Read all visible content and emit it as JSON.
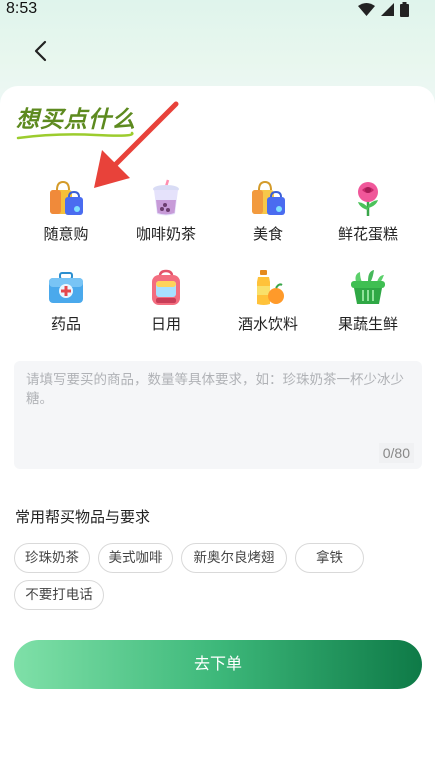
{
  "status_bar": {
    "time": "8:53"
  },
  "slogan": "想买点什么",
  "categories": [
    {
      "label": "随意购",
      "icon": "shopping-bag-icon"
    },
    {
      "label": "咖啡奶茶",
      "icon": "bubble-tea-icon"
    },
    {
      "label": "美食",
      "icon": "food-bag-icon"
    },
    {
      "label": "鲜花蛋糕",
      "icon": "rose-icon"
    },
    {
      "label": "药品",
      "icon": "medicine-box-icon"
    },
    {
      "label": "日用",
      "icon": "backpack-icon"
    },
    {
      "label": "酒水饮料",
      "icon": "drinks-icon"
    },
    {
      "label": "果蔬生鲜",
      "icon": "produce-basket-icon"
    }
  ],
  "request": {
    "placeholder": "请填写要买的商品，数量等具体要求，如：珍珠奶茶一杯少冰少糖。",
    "counter": "0/80"
  },
  "common": {
    "title": "常用帮买物品与要求",
    "tags": [
      "珍珠奶茶",
      "美式咖啡",
      "新奥尔良烤翅",
      "拿铁",
      "不要打电话"
    ]
  },
  "submit_label": "去下单",
  "colors": {
    "primary": "#3db87a",
    "accent_dark": "#0e7a47",
    "slogan": "#5d8a1f",
    "arrow": "#e8423a"
  }
}
